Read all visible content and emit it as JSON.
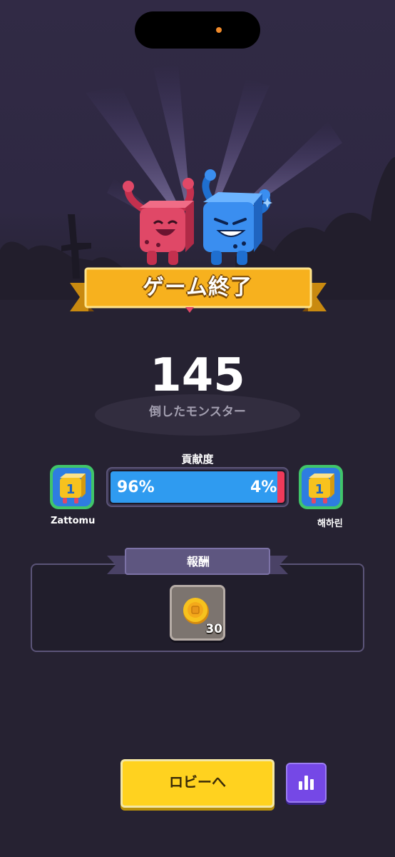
{
  "game_over": {
    "title": "ゲーム終了",
    "score": "145",
    "score_label": "倒したモンスター"
  },
  "contribution": {
    "label": "貢献度",
    "left_player": {
      "name": "Zattomu",
      "percent_text": "96%",
      "percent": 96
    },
    "right_player": {
      "name": "해하린",
      "percent_text": "4%",
      "percent": 4
    }
  },
  "rewards": {
    "title": "報酬",
    "items": [
      {
        "icon": "gold-coin-icon",
        "count": "30"
      }
    ]
  },
  "actions": {
    "lobby_label": "ロビーへ",
    "stats_icon": "bar-chart-icon"
  },
  "colors": {
    "background": "#262232",
    "banner": "#f7b11e",
    "player_blue": "#2f9bf0",
    "player_red": "#ef3a5a",
    "lobby_button": "#ffd21f",
    "stats_button": "#7548e6"
  }
}
